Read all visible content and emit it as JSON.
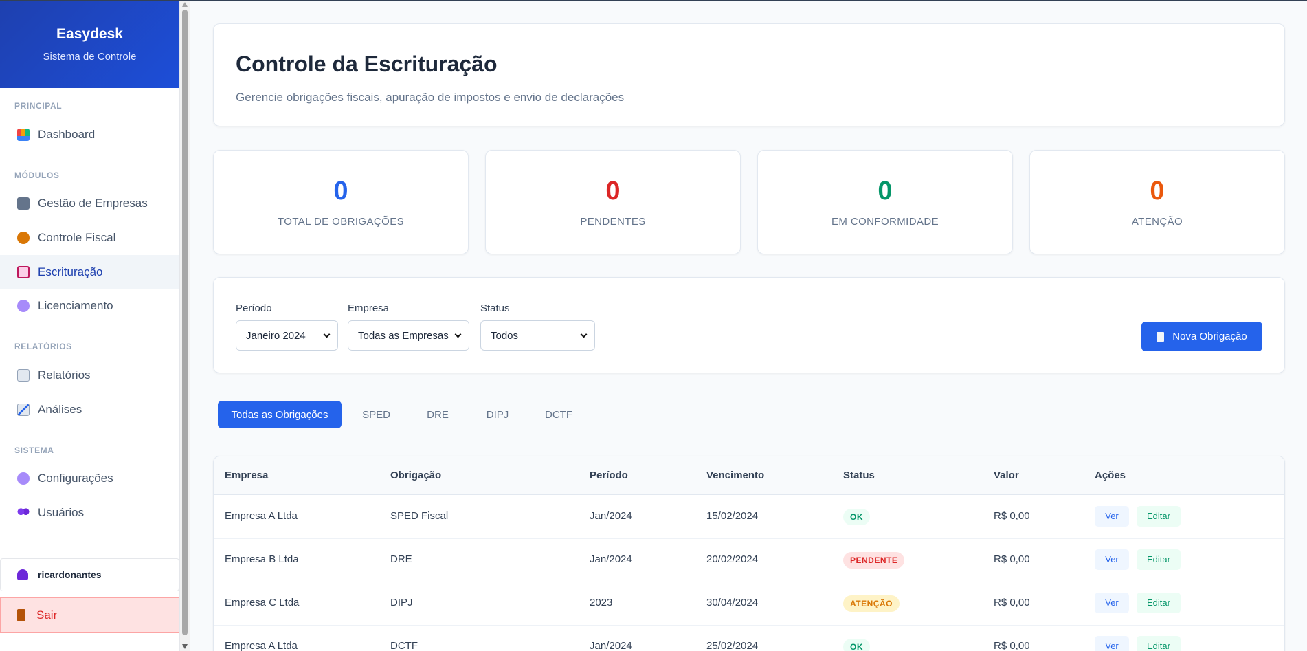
{
  "app": {
    "name": "Easydesk",
    "subtitle": "Sistema de Controle"
  },
  "sidebar": {
    "sections": [
      {
        "title": "PRINCIPAL"
      },
      {
        "title": "MÓDULOS"
      },
      {
        "title": "RELATÓRIOS"
      },
      {
        "title": "SISTEMA"
      }
    ],
    "items": [
      {
        "label": "Dashboard",
        "icon": "chart-bar-icon"
      },
      {
        "label": "Gestão de Empresas",
        "icon": "building-icon"
      },
      {
        "label": "Controle Fiscal",
        "icon": "money-bag-icon"
      },
      {
        "label": "Escrituração",
        "icon": "clipboard-icon",
        "active": true
      },
      {
        "label": "Licenciamento",
        "icon": "gear-icon"
      },
      {
        "label": "Relatórios",
        "icon": "document-icon"
      },
      {
        "label": "Análises",
        "icon": "chart-line-icon"
      },
      {
        "label": "Configurações",
        "icon": "gear-icon"
      },
      {
        "label": "Usuários",
        "icon": "users-icon"
      }
    ],
    "user": "ricardonantes",
    "logout": "Sair"
  },
  "header": {
    "title": "Controle da Escrituração",
    "subtitle": "Gerencie obrigações fiscais, apuração de impostos e envio de declarações"
  },
  "stats": [
    {
      "value": "0",
      "label": "TOTAL DE OBRIGAÇÕES",
      "color": "#2563eb"
    },
    {
      "value": "0",
      "label": "PENDENTES",
      "color": "#dc2626"
    },
    {
      "value": "0",
      "label": "EM CONFORMIDADE",
      "color": "#059669"
    },
    {
      "value": "0",
      "label": "ATENÇÃO",
      "color": "#ea580c"
    }
  ],
  "filters": {
    "periodo": {
      "label": "Período",
      "value": "Janeiro 2024"
    },
    "empresa": {
      "label": "Empresa",
      "value": "Todas as Empresas"
    },
    "status": {
      "label": "Status",
      "value": "Todos"
    },
    "new_button": "Nova Obrigação"
  },
  "tabs": [
    "Todas as Obrigações",
    "SPED",
    "DRE",
    "DIPJ",
    "DCTF"
  ],
  "table": {
    "columns": [
      "Empresa",
      "Obrigação",
      "Período",
      "Vencimento",
      "Status",
      "Valor",
      "Ações"
    ],
    "rows": [
      {
        "empresa": "Empresa A Ltda",
        "obrigacao": "SPED Fiscal",
        "periodo": "Jan/2024",
        "vencimento": "15/02/2024",
        "status": "OK",
        "valor": "R$ 0,00"
      },
      {
        "empresa": "Empresa B Ltda",
        "obrigacao": "DRE",
        "periodo": "Jan/2024",
        "vencimento": "20/02/2024",
        "status": "PENDENTE",
        "valor": "R$ 0,00"
      },
      {
        "empresa": "Empresa C Ltda",
        "obrigacao": "DIPJ",
        "periodo": "2023",
        "vencimento": "30/04/2024",
        "status": "ATENÇÃO",
        "valor": "R$ 0,00"
      },
      {
        "empresa": "Empresa A Ltda",
        "obrigacao": "DCTF",
        "periodo": "Jan/2024",
        "vencimento": "25/02/2024",
        "status": "OK",
        "valor": "R$ 0,00"
      }
    ],
    "actions": {
      "view": "Ver",
      "edit": "Editar"
    }
  }
}
